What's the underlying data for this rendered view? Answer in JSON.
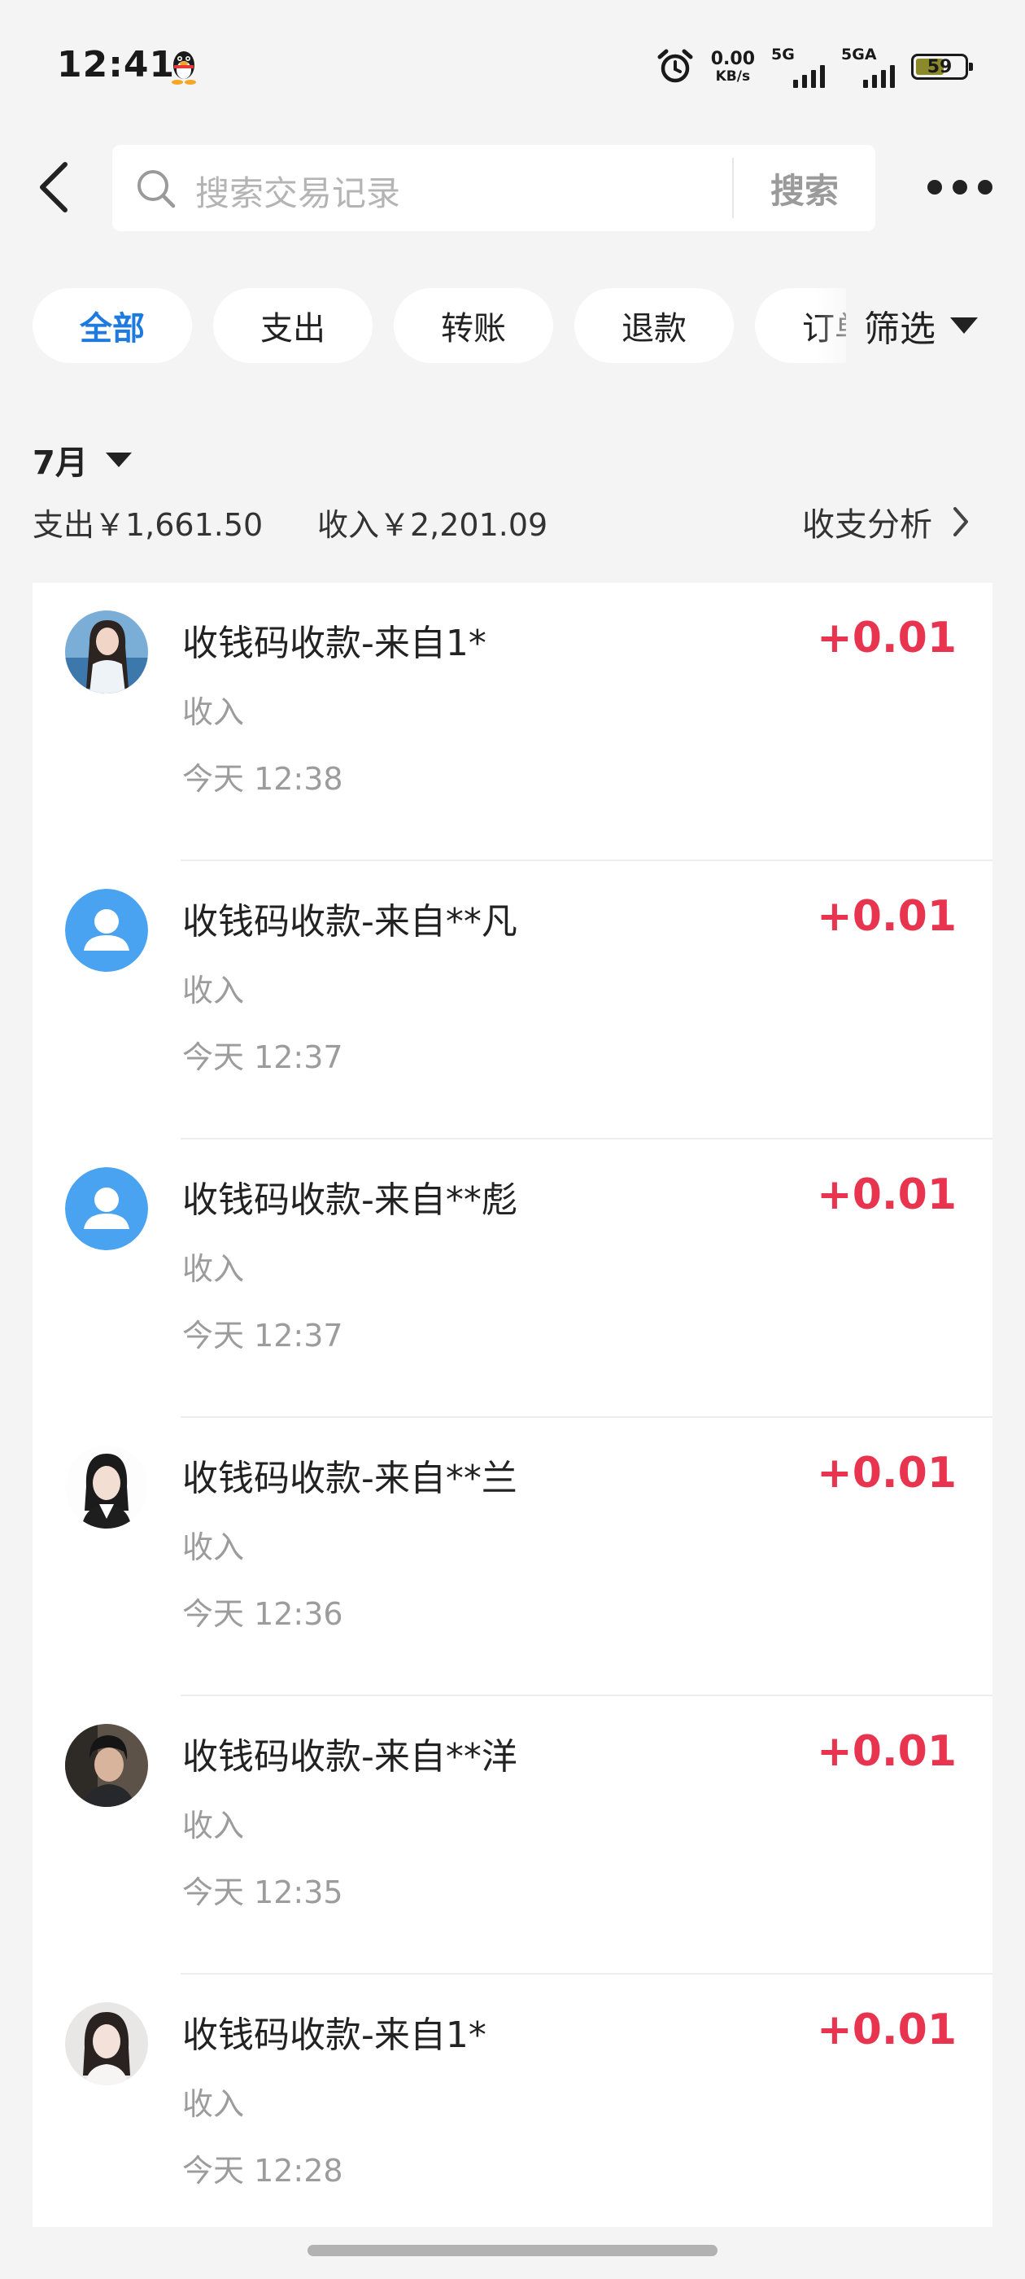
{
  "status_bar": {
    "time": "12:41",
    "net_speed_value": "0.00",
    "net_speed_unit": "KB/s",
    "sim1_label": "5G",
    "sim2_label": "5GA",
    "battery": "59",
    "icons": [
      "qq-penguin-icon",
      "alarm-icon",
      "signal-icon",
      "battery-icon"
    ]
  },
  "header": {
    "search_placeholder": "搜索交易记录",
    "search_button": "搜索"
  },
  "filters": {
    "chips": [
      "全部",
      "支出",
      "转账",
      "退款",
      "订单"
    ],
    "active_index": 0,
    "filter_label": "筛选"
  },
  "summary": {
    "month": "7月",
    "expense": "支出￥1,661.50",
    "income": "收入￥2,201.09",
    "analysis_label": "收支分析"
  },
  "transactions": [
    {
      "title": "收钱码收款-来自1*",
      "type": "收入",
      "time": "今天 12:38",
      "amount": "+0.01",
      "avatar": "photo"
    },
    {
      "title": "收钱码收款-来自**凡",
      "type": "收入",
      "time": "今天 12:37",
      "amount": "+0.01",
      "avatar": "default"
    },
    {
      "title": "收钱码收款-来自**彪",
      "type": "收入",
      "time": "今天 12:37",
      "amount": "+0.01",
      "avatar": "default"
    },
    {
      "title": "收钱码收款-来自**兰",
      "type": "收入",
      "time": "今天 12:36",
      "amount": "+0.01",
      "avatar": "photo"
    },
    {
      "title": "收钱码收款-来自**洋",
      "type": "收入",
      "time": "今天 12:35",
      "amount": "+0.01",
      "avatar": "photo"
    },
    {
      "title": "收钱码收款-来自1*",
      "type": "收入",
      "time": "今天 12:28",
      "amount": "+0.01",
      "avatar": "photo"
    }
  ],
  "colors": {
    "accent": "#1f7ae0",
    "income_red": "#e8344e",
    "default_avatar": "#4aa3f0"
  }
}
